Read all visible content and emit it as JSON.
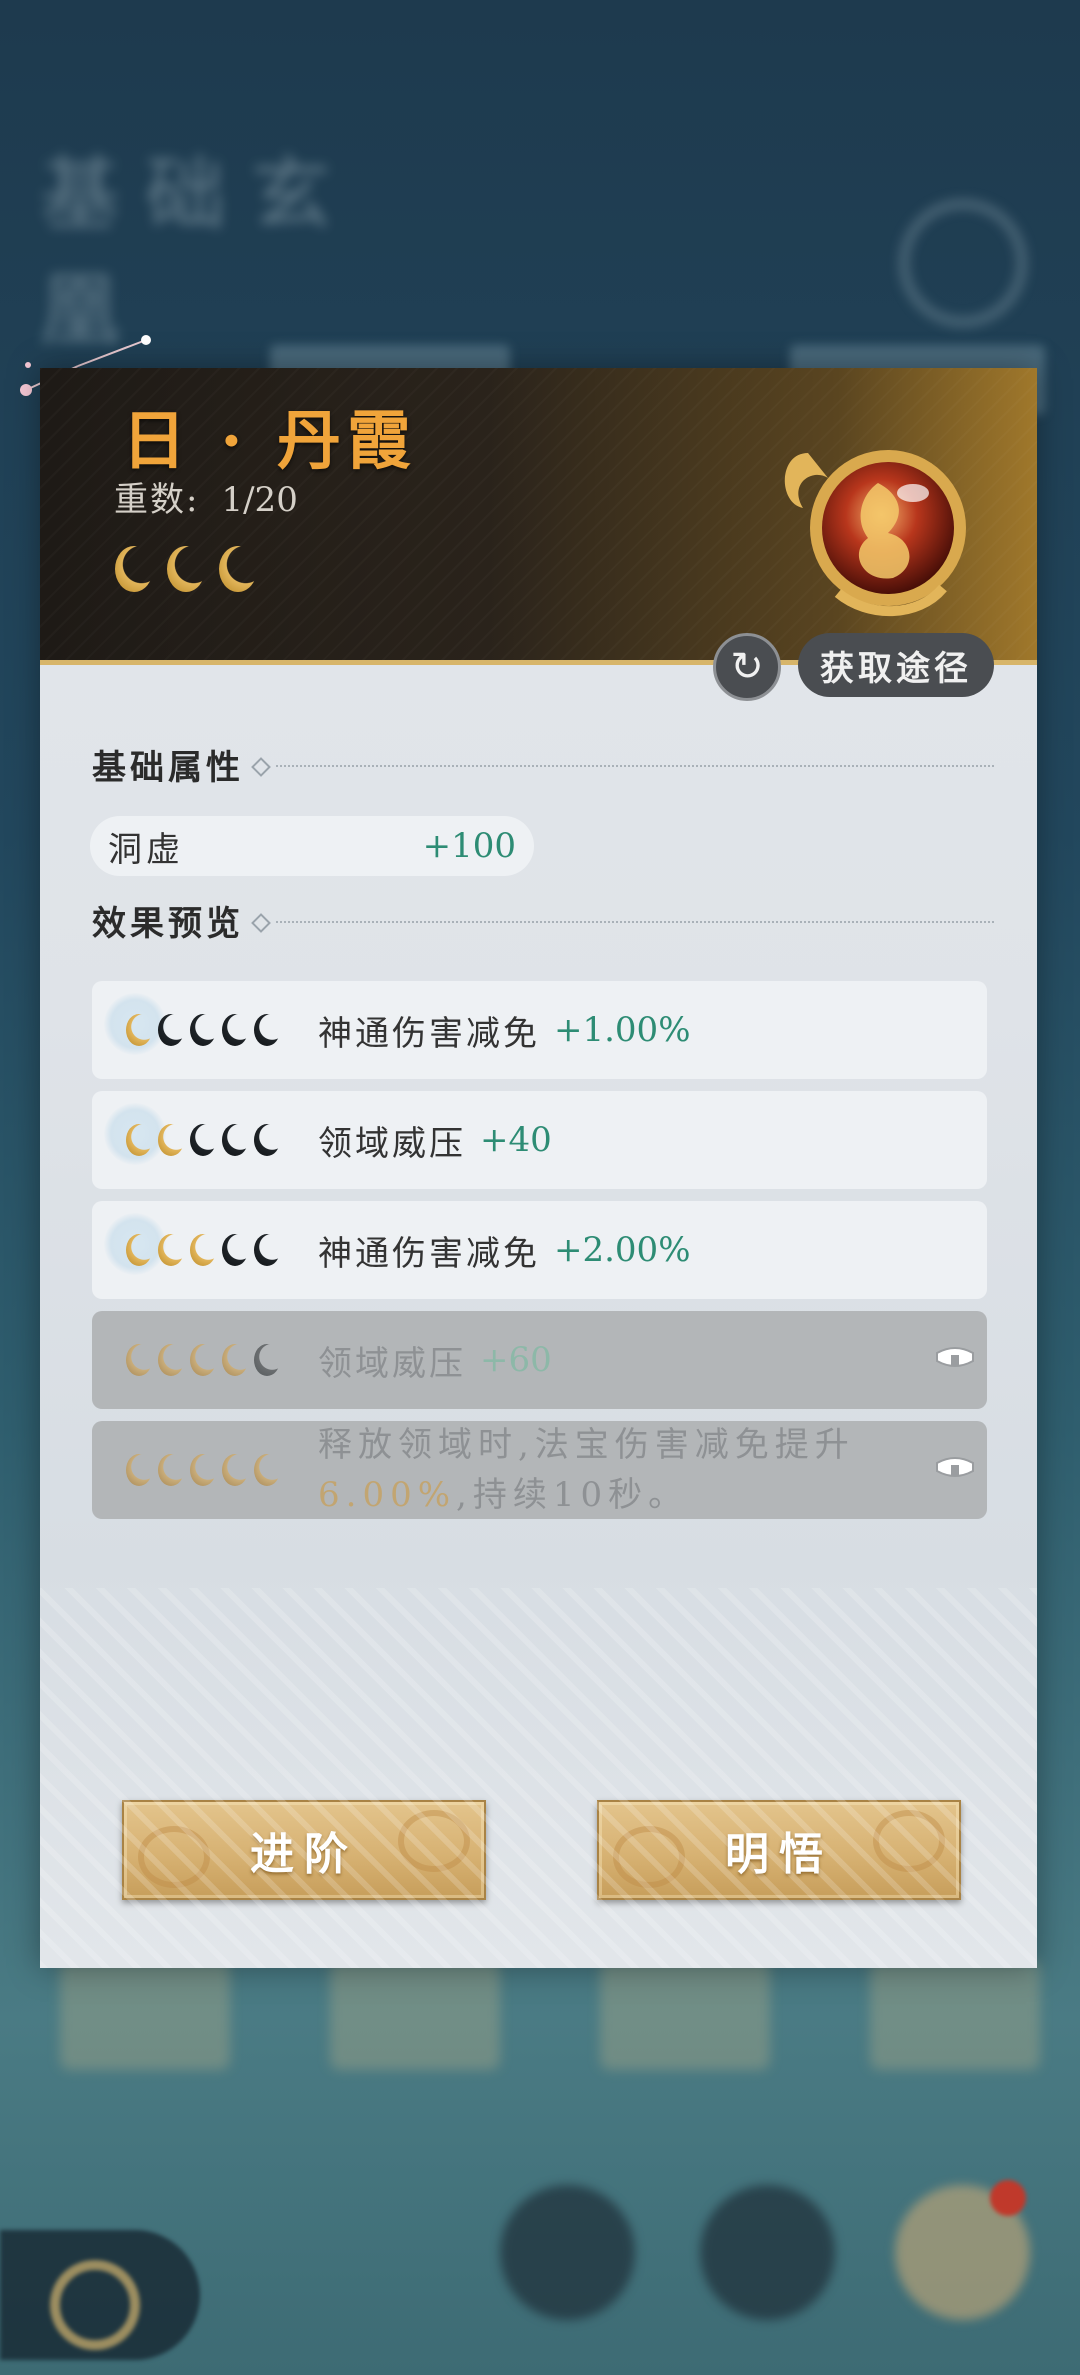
{
  "item": {
    "title": "日 · 丹霞",
    "layer_label": "重数:",
    "layer_value": "1/20",
    "stars_filled": 3
  },
  "actions": {
    "source_label": "获取途径",
    "refresh_icon": "refresh-icon",
    "advance_label": "进阶",
    "comprehend_label": "明悟"
  },
  "base": {
    "section_title": "基础属性",
    "stat_name": "洞虚",
    "stat_value": "+100"
  },
  "effects": {
    "section_title": "效果预览",
    "rows": [
      {
        "filled": 1,
        "desc": "神通伤害减免",
        "value": "+1.00%",
        "locked": false
      },
      {
        "filled": 2,
        "desc": "领域威压",
        "value": "+40",
        "locked": false
      },
      {
        "filled": 3,
        "desc": "神通伤害减免",
        "value": "+2.00%",
        "locked": false
      },
      {
        "filled": 4,
        "desc": "领域威压",
        "value": "+60",
        "locked": true
      },
      {
        "filled": 5,
        "desc_line1": "释放领域时,法宝伤害减免提升",
        "desc_highlight": "6.00%",
        "desc_line2": ",持续10秒。",
        "locked": true
      }
    ]
  },
  "colors": {
    "title": "#f0a43a",
    "value_green": "#2d8c74",
    "moon_gold": "#e2b55a",
    "moon_dark": "#1f2428"
  }
}
